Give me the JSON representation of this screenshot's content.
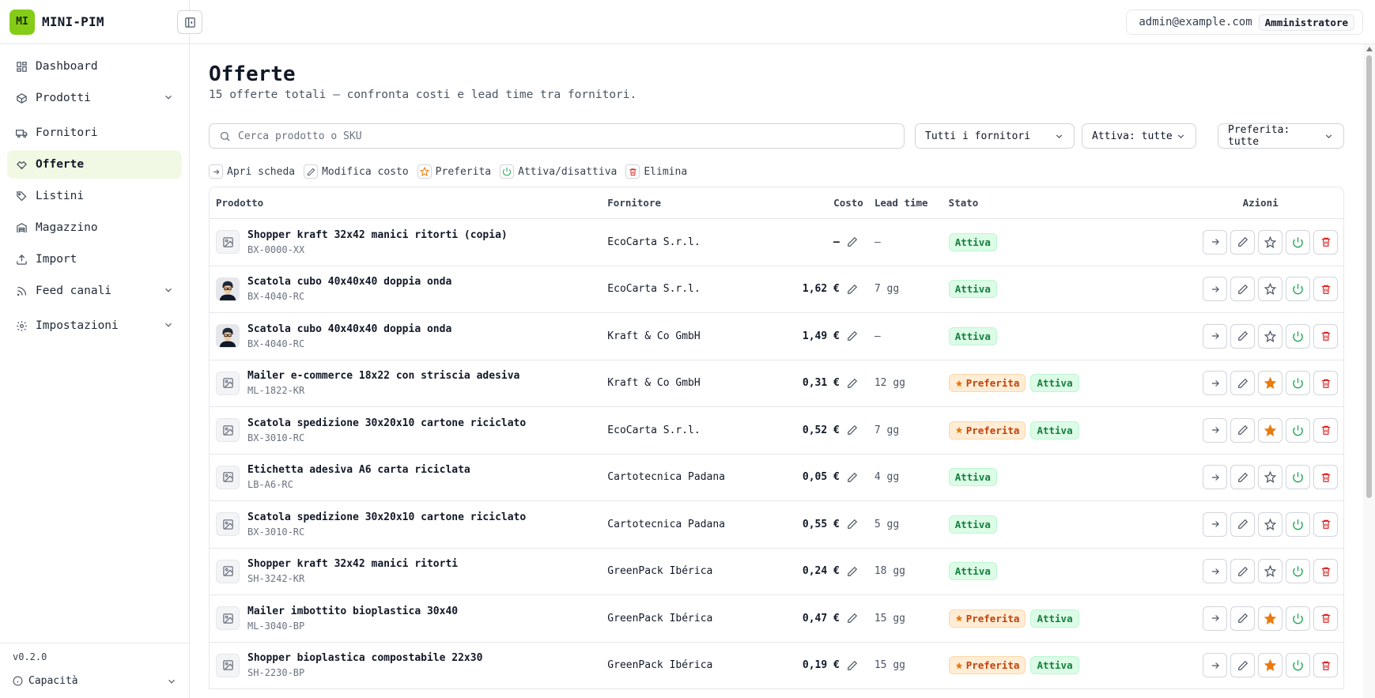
{
  "app": {
    "logo_text": "MI",
    "name": "MINI-PIM",
    "version": "v0.2.0"
  },
  "user": {
    "email": "admin@example.com",
    "role": "Amministratore"
  },
  "sidebar": {
    "items": [
      {
        "label": "Dashboard",
        "icon": "dashboard-icon"
      },
      {
        "label": "Prodotti",
        "icon": "package-icon",
        "expandable": true
      },
      {
        "label": "Fornitori",
        "icon": "truck-icon"
      },
      {
        "label": "Offerte",
        "icon": "handshake-icon",
        "active": true
      },
      {
        "label": "Listini",
        "icon": "tag-icon"
      },
      {
        "label": "Magazzino",
        "icon": "warehouse-icon"
      },
      {
        "label": "Import",
        "icon": "upload-icon"
      },
      {
        "label": "Feed canali",
        "icon": "rss-icon",
        "expandable": true
      },
      {
        "label": "Impostazioni",
        "icon": "gear-icon",
        "expandable": true
      }
    ],
    "footer_capacity": "Capacità"
  },
  "page": {
    "title": "Offerte",
    "subtitle": "15 offerte totali — confronta costi e lead time tra fornitori.",
    "search_placeholder": "Cerca prodotto o SKU",
    "filters": {
      "supplier": "Tutti i fornitori",
      "active": "Attiva: tutte",
      "preferred": "Preferita: tutte"
    },
    "legend": {
      "open": "Apri scheda",
      "edit_cost": "Modifica costo",
      "preferred": "Preferita",
      "toggle": "Attiva/disattiva",
      "delete": "Elimina"
    }
  },
  "table": {
    "headers": {
      "product": "Prodotto",
      "supplier": "Fornitore",
      "cost": "Costo",
      "lead": "Lead time",
      "status": "Stato",
      "actions": "Azioni"
    },
    "badge_active": "Attiva",
    "badge_preferred": "Preferita",
    "rows": [
      {
        "name": "Shopper kraft 32x42 manici ritorti (copia)",
        "sku": "BX-0000-XX",
        "supplier": "EcoCarta S.r.l.",
        "cost": "–",
        "lead": "–",
        "preferred": false,
        "active": true,
        "thumb": "image"
      },
      {
        "name": "Scatola cubo 40x40x40 doppia onda",
        "sku": "BX-4040-RC",
        "supplier": "EcoCarta S.r.l.",
        "cost": "1,62 €",
        "lead": "7 gg",
        "preferred": false,
        "active": true,
        "thumb": "avatar"
      },
      {
        "name": "Scatola cubo 40x40x40 doppia onda",
        "sku": "BX-4040-RC",
        "supplier": "Kraft & Co GmbH",
        "cost": "1,49 €",
        "lead": "–",
        "preferred": false,
        "active": true,
        "thumb": "avatar"
      },
      {
        "name": "Mailer e-commerce 18x22 con striscia adesiva",
        "sku": "ML-1822-KR",
        "supplier": "Kraft & Co GmbH",
        "cost": "0,31 €",
        "lead": "12 gg",
        "preferred": true,
        "active": true,
        "thumb": "image"
      },
      {
        "name": "Scatola spedizione 30x20x10 cartone riciclato",
        "sku": "BX-3010-RC",
        "supplier": "EcoCarta S.r.l.",
        "cost": "0,52 €",
        "lead": "7 gg",
        "preferred": true,
        "active": true,
        "thumb": "image"
      },
      {
        "name": "Etichetta adesiva A6 carta riciclata",
        "sku": "LB-A6-RC",
        "supplier": "Cartotecnica Padana",
        "cost": "0,05 €",
        "lead": "4 gg",
        "preferred": false,
        "active": true,
        "thumb": "image"
      },
      {
        "name": "Scatola spedizione 30x20x10 cartone riciclato",
        "sku": "BX-3010-RC",
        "supplier": "Cartotecnica Padana",
        "cost": "0,55 €",
        "lead": "5 gg",
        "preferred": false,
        "active": true,
        "thumb": "image"
      },
      {
        "name": "Shopper kraft 32x42 manici ritorti",
        "sku": "SH-3242-KR",
        "supplier": "GreenPack Ibérica",
        "cost": "0,24 €",
        "lead": "18 gg",
        "preferred": false,
        "active": true,
        "thumb": "image"
      },
      {
        "name": "Mailer imbottito bioplastica 30x40",
        "sku": "ML-3040-BP",
        "supplier": "GreenPack Ibérica",
        "cost": "0,47 €",
        "lead": "15 gg",
        "preferred": true,
        "active": true,
        "thumb": "image"
      },
      {
        "name": "Shopper bioplastica compostabile 22x30",
        "sku": "SH-2230-BP",
        "supplier": "GreenPack Ibérica",
        "cost": "0,19 €",
        "lead": "15 gg",
        "preferred": true,
        "active": true,
        "thumb": "image"
      }
    ]
  },
  "colors": {
    "accent": "#84cc16",
    "active_green": "#15803d",
    "preferred_orange": "#ea7a0c",
    "delete_red": "#dc2626"
  }
}
